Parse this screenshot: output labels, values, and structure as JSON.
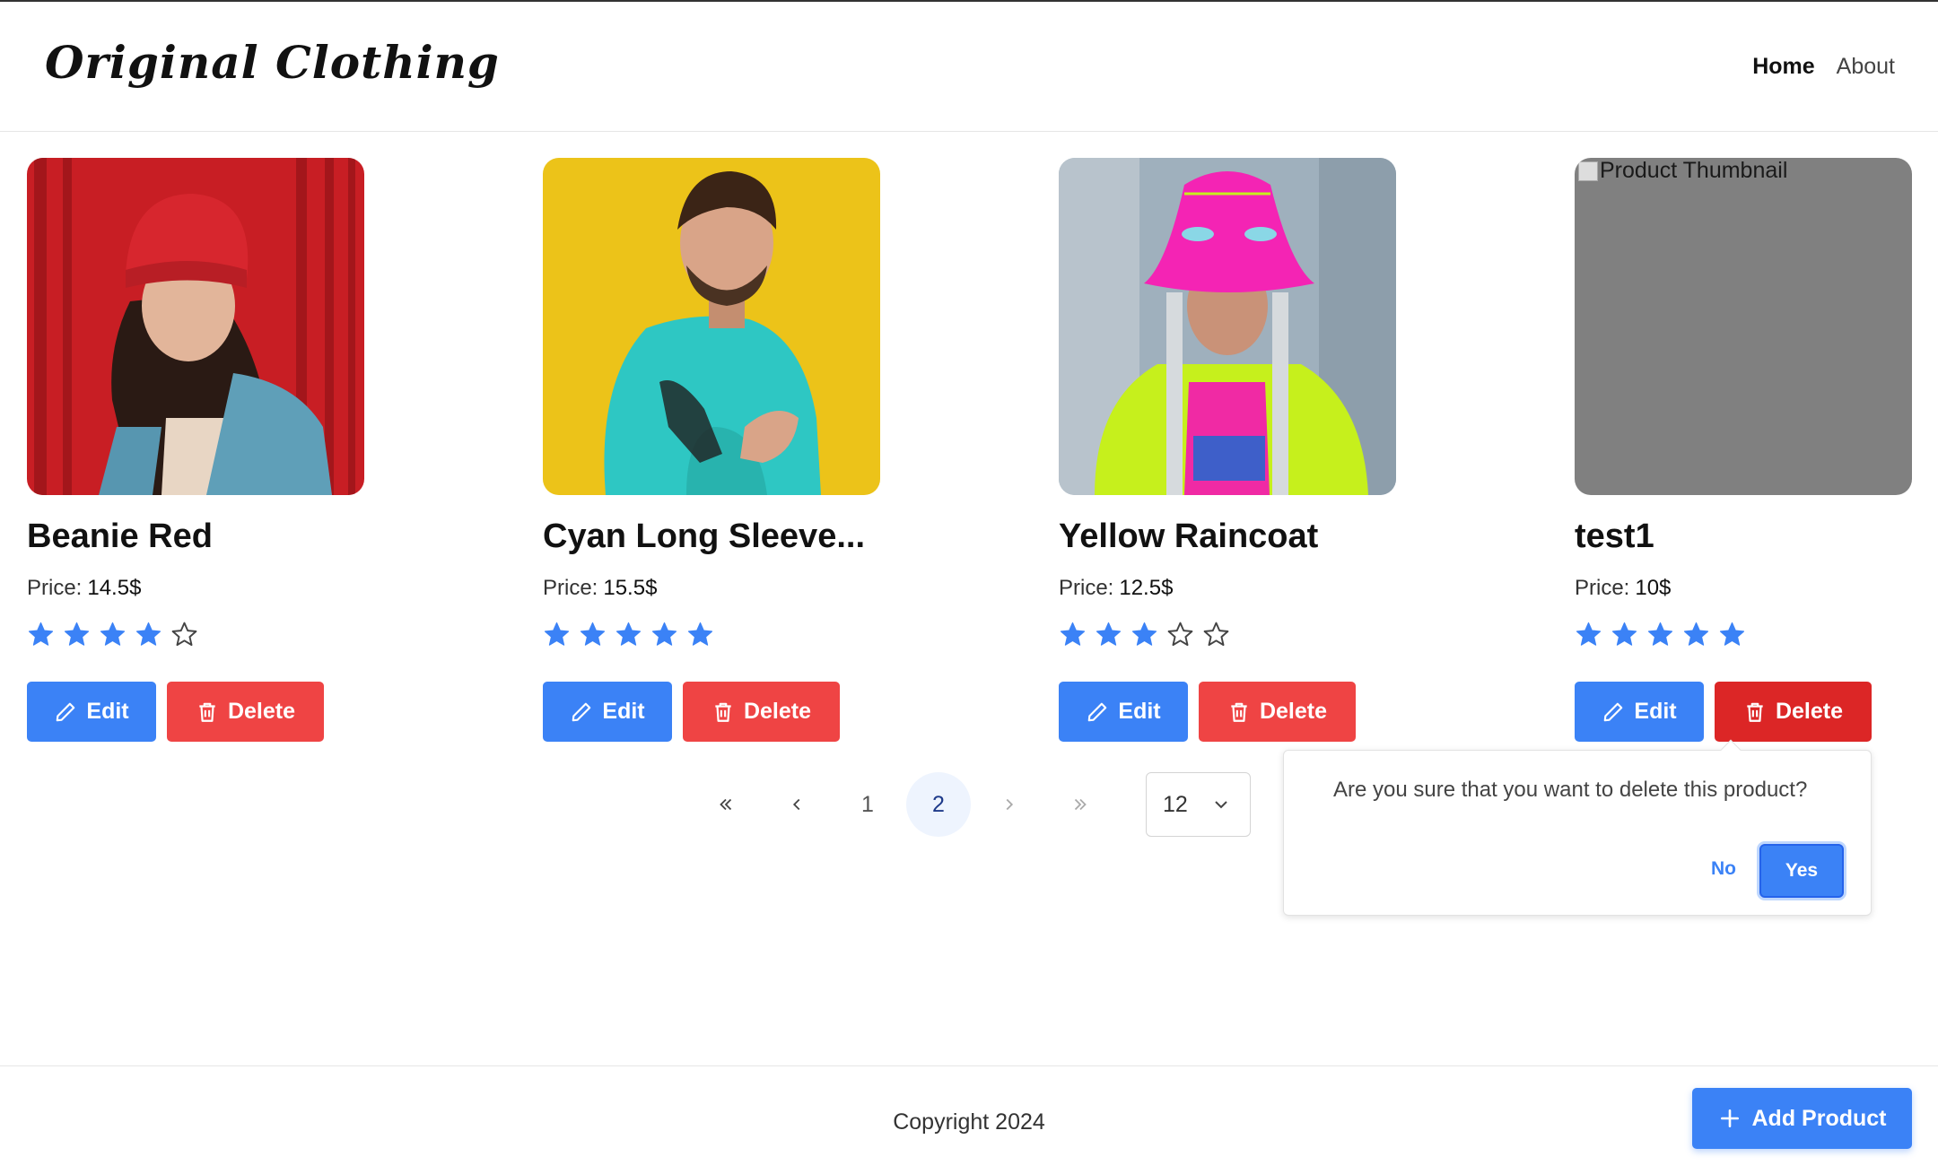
{
  "header": {
    "brand": "Original Clothing",
    "nav": {
      "home": "Home",
      "about": "About"
    }
  },
  "products": [
    {
      "name": "Beanie Red",
      "price_label": "Price:",
      "price": "14.5$",
      "rating": 4,
      "edit_label": "Edit",
      "delete_label": "Delete"
    },
    {
      "name": "Cyan Long Sleeve...",
      "price_label": "Price:",
      "price": "15.5$",
      "rating": 5,
      "edit_label": "Edit",
      "delete_label": "Delete"
    },
    {
      "name": "Yellow Raincoat",
      "price_label": "Price:",
      "price": "12.5$",
      "rating": 3,
      "edit_label": "Edit",
      "delete_label": "Delete"
    },
    {
      "name": "test1",
      "price_label": "Price:",
      "price": "10$",
      "rating": 5,
      "edit_label": "Edit",
      "delete_label": "Delete",
      "thumbnail_alt": "Product Thumbnail"
    }
  ],
  "pagination": {
    "pages": [
      "1",
      "2"
    ],
    "current": "2",
    "per_page": "12"
  },
  "confirm_popup": {
    "message": "Are you sure that you want to delete this product?",
    "no_label": "No",
    "yes_label": "Yes"
  },
  "footer": {
    "copyright": "Copyright 2024",
    "add_label": "Add Product"
  },
  "colors": {
    "primary": "#3b82f6",
    "danger": "#ef4444",
    "star": "#3b82f6"
  }
}
